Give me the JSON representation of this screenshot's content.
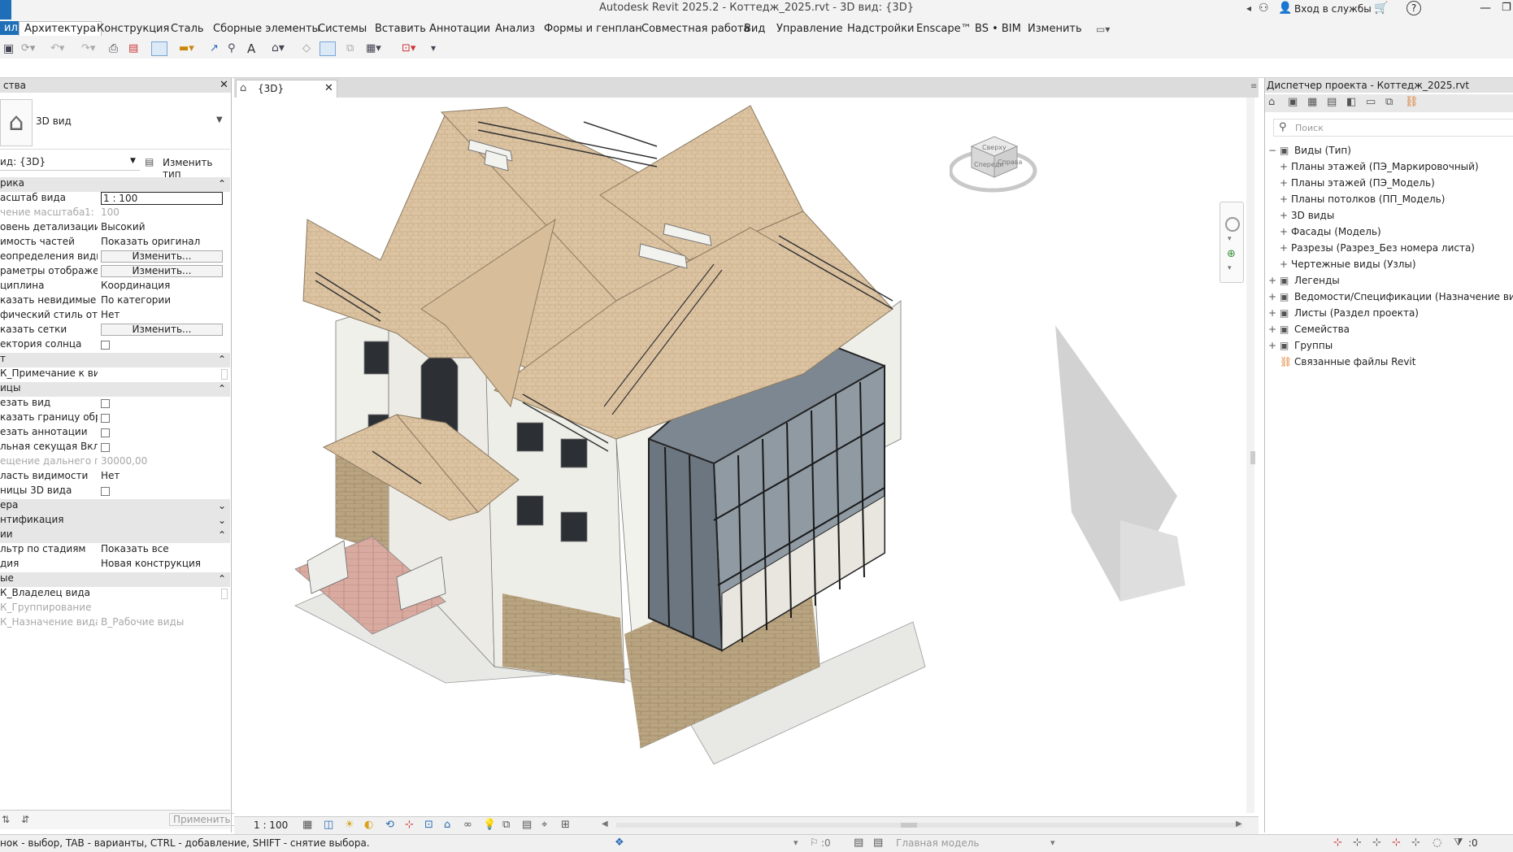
{
  "window": {
    "title": "Autodesk Revit 2025.2 - Коттедж_2025.rvt - 3D вид: {3D}"
  },
  "titlebar_right": {
    "sign_in": "Вход в службы"
  },
  "menu": [
    {
      "label": "ил"
    },
    {
      "label": "Архитектура"
    },
    {
      "label": "Конструкция"
    },
    {
      "label": "Сталь"
    },
    {
      "label": "Сборные элементы"
    },
    {
      "label": "Системы"
    },
    {
      "label": "Вставить"
    },
    {
      "label": "Аннотации"
    },
    {
      "label": "Анализ"
    },
    {
      "label": "Формы и генплан"
    },
    {
      "label": "Совместная работа"
    },
    {
      "label": "Вид"
    },
    {
      "label": "Управление"
    },
    {
      "label": "Надстройки"
    },
    {
      "label": "Enscape™"
    },
    {
      "label": "BS • BIM"
    },
    {
      "label": "Изменить"
    }
  ],
  "properties": {
    "header": "ства",
    "type_name": "3D вид",
    "view_selector": "ид: {3D}",
    "edit_type": "Изменить тип",
    "rows": [
      {
        "k": "рика",
        "v": "",
        "kind": "group",
        "arrow": "⌃"
      },
      {
        "k": "асштаб вида",
        "v": "1 : 100",
        "kind": "input"
      },
      {
        "k": "чение масштаба",
        "v": "100",
        "extra": "1:",
        "kind": "gray"
      },
      {
        "k": "овень детализации",
        "v": "Высокий"
      },
      {
        "k": "имость частей",
        "v": "Показать оригинал"
      },
      {
        "k": "еопределения види...",
        "v": "Изменить...",
        "kind": "btn"
      },
      {
        "k": "раметры отображен...",
        "v": "Изменить...",
        "kind": "btn"
      },
      {
        "k": "циплина",
        "v": "Координация"
      },
      {
        "k": "казать невидимые л...",
        "v": "По категории"
      },
      {
        "k": "фический стиль ото...",
        "v": "Нет"
      },
      {
        "k": "казать сетки",
        "v": "Изменить...",
        "kind": "btn"
      },
      {
        "k": "ектория солнца",
        "v": "",
        "kind": "cb"
      },
      {
        "k": "т",
        "v": "",
        "kind": "group",
        "arrow": "⌃"
      },
      {
        "k": "К_Примечание к ви...",
        "v": "",
        "kind": "edge"
      },
      {
        "k": "ицы",
        "v": "",
        "kind": "group",
        "arrow": "⌃"
      },
      {
        "k": "езать вид",
        "v": "",
        "kind": "cb"
      },
      {
        "k": "казать границу обре...",
        "v": "",
        "kind": "cb"
      },
      {
        "k": "езать аннотации",
        "v": "",
        "kind": "cb"
      },
      {
        "k": "льная секущая Вкл",
        "v": "",
        "kind": "cb"
      },
      {
        "k": "ещение дальнего пр...",
        "v": "30000,00",
        "kind": "gray"
      },
      {
        "k": "ласть видимости",
        "v": "Нет"
      },
      {
        "k": "ницы 3D вида",
        "v": "",
        "kind": "cb"
      },
      {
        "k": "ера",
        "v": "",
        "kind": "group",
        "arrow": "⌄"
      },
      {
        "k": "нтификация",
        "v": "",
        "kind": "group",
        "arrow": "⌄"
      },
      {
        "k": "ии",
        "v": "",
        "kind": "group",
        "arrow": "⌃"
      },
      {
        "k": "льтр по стадиям",
        "v": "Показать все"
      },
      {
        "k": "дия",
        "v": "Новая конструкция"
      },
      {
        "k": "ые",
        "v": "",
        "kind": "group",
        "arrow": "⌃"
      },
      {
        "k": "К_Владелец вида",
        "v": "",
        "kind": "edge"
      },
      {
        "k": "К_Группирование",
        "v": "",
        "kind": "grayk"
      },
      {
        "k": "К_Назначение вида",
        "v": "В_Рабочие виды",
        "kind": "grayk"
      }
    ],
    "apply": "Применить"
  },
  "view": {
    "tab": "{3D}",
    "scale": "1 : 100"
  },
  "project_browser": {
    "title": "Диспетчер проекта - Коттедж_2025.rvt",
    "search_placeholder": "Поиск",
    "items": [
      {
        "label": "Виды (Тип)",
        "level": 0,
        "exp": "−"
      },
      {
        "label": "Планы этажей (ПЭ_Маркировочный)",
        "level": 1,
        "exp": "+"
      },
      {
        "label": "Планы этажей (ПЭ_Модель)",
        "level": 1,
        "exp": "+"
      },
      {
        "label": "Планы потолков (ПП_Модель)",
        "level": 1,
        "exp": "+"
      },
      {
        "label": "3D виды",
        "level": 1,
        "exp": "+"
      },
      {
        "label": "Фасады (Модель)",
        "level": 1,
        "exp": "+"
      },
      {
        "label": "Разрезы (Разрез_Без номера листа)",
        "level": 1,
        "exp": "+"
      },
      {
        "label": "Чертежные виды (Узлы)",
        "level": 1,
        "exp": "+"
      },
      {
        "label": "Легенды",
        "level": 0,
        "exp": "+"
      },
      {
        "label": "Ведомости/Спецификации (Назначение вида)",
        "level": 0,
        "exp": "+"
      },
      {
        "label": "Листы (Раздел проекта)",
        "level": 0,
        "exp": "+"
      },
      {
        "label": "Семейства",
        "level": 0,
        "exp": "+"
      },
      {
        "label": "Группы",
        "level": 0,
        "exp": "+"
      },
      {
        "label": "Связанные файлы Revit",
        "level": 0,
        "exp": ""
      }
    ]
  },
  "viewcube": {
    "top": "Сверху",
    "front": "Спереди",
    "right": "Справа"
  },
  "status": {
    "hint": "нок - выбор, TAB - варианты, CTRL - добавление, SHIFT - снятие выбора.",
    "workset_count": ":0",
    "model": "Главная модель",
    "filter_count": ":0"
  },
  "colors": {
    "accent": "#0a72c8",
    "roof": "#dcc3a1",
    "wall": "#efefea",
    "stone": "#b49e7c"
  }
}
